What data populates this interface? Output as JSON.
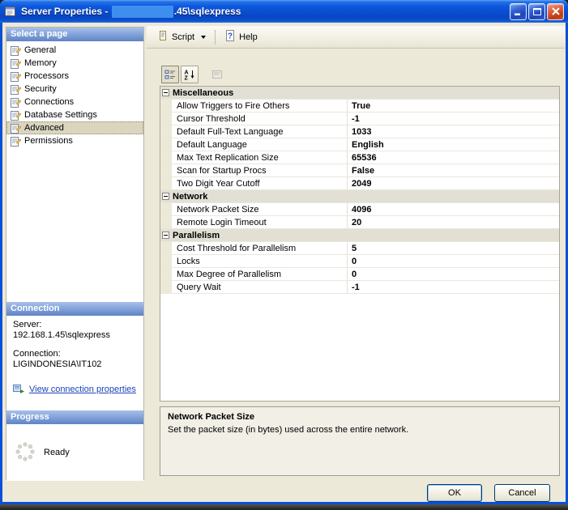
{
  "window": {
    "title_prefix": "Server Properties - ",
    "title_suffix": ".45\\sqlexpress"
  },
  "toolbar": {
    "script_label": "Script",
    "help_label": "Help"
  },
  "sidebar": {
    "select_page_header": "Select a page",
    "pages": [
      {
        "label": "General",
        "selected": false
      },
      {
        "label": "Memory",
        "selected": false
      },
      {
        "label": "Processors",
        "selected": false
      },
      {
        "label": "Security",
        "selected": false
      },
      {
        "label": "Connections",
        "selected": false
      },
      {
        "label": "Database Settings",
        "selected": false
      },
      {
        "label": "Advanced",
        "selected": true
      },
      {
        "label": "Permissions",
        "selected": false
      }
    ],
    "connection": {
      "header": "Connection",
      "server_label": "Server:",
      "server_value": "192.168.1.45\\sqlexpress",
      "connection_label": "Connection:",
      "connection_value": "LIGINDONESIA\\IT102",
      "view_link": "View connection properties"
    },
    "progress": {
      "header": "Progress",
      "status": "Ready"
    }
  },
  "property_grid": {
    "categories": [
      {
        "name": "Miscellaneous",
        "rows": [
          {
            "label": "Allow Triggers to Fire Others",
            "value": "True"
          },
          {
            "label": "Cursor Threshold",
            "value": "-1"
          },
          {
            "label": "Default Full-Text Language",
            "value": "1033"
          },
          {
            "label": "Default Language",
            "value": "English"
          },
          {
            "label": "Max Text Replication Size",
            "value": "65536"
          },
          {
            "label": "Scan for Startup Procs",
            "value": "False"
          },
          {
            "label": "Two Digit Year Cutoff",
            "value": "2049"
          }
        ]
      },
      {
        "name": "Network",
        "rows": [
          {
            "label": "Network Packet Size",
            "value": "4096"
          },
          {
            "label": "Remote Login Timeout",
            "value": "20"
          }
        ]
      },
      {
        "name": "Parallelism",
        "rows": [
          {
            "label": "Cost Threshold for Parallelism",
            "value": "5"
          },
          {
            "label": "Locks",
            "value": "0"
          },
          {
            "label": "Max Degree of Parallelism",
            "value": "0"
          },
          {
            "label": "Query Wait",
            "value": "-1"
          }
        ]
      }
    ],
    "description": {
      "title": "Network Packet Size",
      "text": "Set the packet size (in bytes) used across the entire network."
    }
  },
  "footer": {
    "ok_label": "OK",
    "cancel_label": "Cancel"
  },
  "colors": {
    "titlebar_blue": "#0A50D8",
    "dialog_bg": "#ECE9D8",
    "panel_header_blue": "#7E9FD8",
    "selected_page_bg": "#DAD5BF",
    "close_button_red": "#D05028",
    "link_blue": "#1C44B8",
    "redacted_patch_blue": "#3E8EF0"
  },
  "icons": [
    "window-icon",
    "minimize-icon",
    "maximize-icon",
    "close-icon",
    "script-icon",
    "dropdown-arrow-icon",
    "help-icon",
    "page-icon",
    "view-connection-properties-icon",
    "progress-spinner-icon",
    "categorized-icon",
    "sort-alphabetical-icon",
    "property-pages-icon",
    "collapse-icon"
  ]
}
